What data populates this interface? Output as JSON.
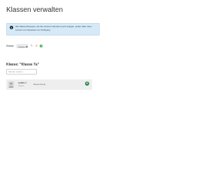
{
  "page": {
    "title": "Klassen verwalten"
  },
  "info": {
    "icon": "info-icon",
    "text": "Alle Klassen/Gruppen, die Sie mit dem Infomkon touch anlegen, stehen allen Ihren Lehrern zum Erpassen zur Verfügung."
  },
  "class_selector": {
    "label": "Klasse:",
    "selected": "Klasse 7a",
    "icons": [
      "edit-icon",
      "delete-icon",
      "add-icon"
    ]
  },
  "class_section": {
    "heading": "Klasse: \"Klasse 7a\"",
    "search_placeholder": "Schüler suchen"
  },
  "students": [
    {
      "name": "sudes 1",
      "sub": "Klassen",
      "role": "Name Anmel",
      "action_icon": "plus-icon"
    }
  ],
  "colors": {
    "info_bg": "#d6e9f7",
    "card_bg": "#eeeeee",
    "accent_green": "#2e8b57",
    "delete_red": "#d9534f"
  }
}
